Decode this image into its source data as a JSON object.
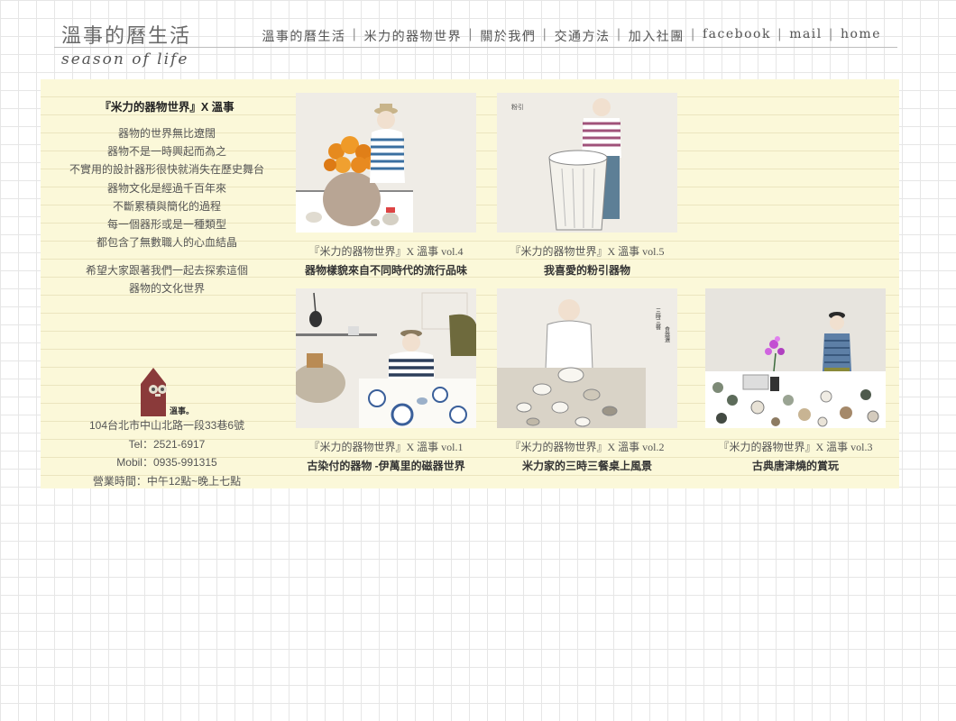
{
  "header": {
    "logo_cn": "溫事的曆生活",
    "logo_en": "season of life",
    "nav": [
      "溫事的曆生活",
      "米力的器物世界",
      "關於我們",
      "交通方法",
      "加入社團",
      "facebook",
      "mail",
      "home"
    ]
  },
  "intro": {
    "title": "『米力的器物世界』X 溫事",
    "lines": [
      "器物的世界無比遼闊",
      "器物不是一時興起而為之",
      "不實用的設計器形很快就消失在歷史舞台",
      "器物文化是經過千百年來",
      "不斷累積與簡化的過程",
      "每一個器形或是一種類型",
      "都包含了無數職人的心血結晶"
    ],
    "lines2": [
      "希望大家跟著我們一起去探索這個",
      "器物的文化世界"
    ],
    "logo_text": "溫事。",
    "contact": [
      "104台北市中山北路一段33巷6號",
      "Tel：2521-6917",
      "Mobil：0935-991315",
      "營業時間：中午12點~晚上七點"
    ]
  },
  "articles": [
    {
      "sub": "『米力的器物世界』X 溫事 vol.4",
      "title": "器物樣貌來自不同時代的流行品味",
      "thumb": "man-hat-orange-flowers-vase-illustration"
    },
    {
      "sub": "『米力的器物世界』X 溫事 vol.5",
      "title": "我喜愛的粉引器物",
      "thumb": "man-large-white-fluted-jar-illustration",
      "thumb_text": "粉引"
    },
    {
      "sub": "『米力的器物世界』X 溫事 vol.1",
      "title": "古染付的器物 -伊萬里的磁器世界",
      "thumb": "man-blue-white-plates-table-illustration"
    },
    {
      "sub": "『米力的器物世界』X 溫事 vol.2",
      "title": "米力家的三時三餐桌上風景",
      "thumb": "man-bowls-on-table-illustration",
      "thumb_text": [
        "三時三餐",
        "食器選"
      ]
    },
    {
      "sub": "『米力的器物世界』X 溫事 vol.3",
      "title": "古典唐津燒的賞玩",
      "thumb": "man-karatsu-ware-collection-illustration"
    }
  ]
}
